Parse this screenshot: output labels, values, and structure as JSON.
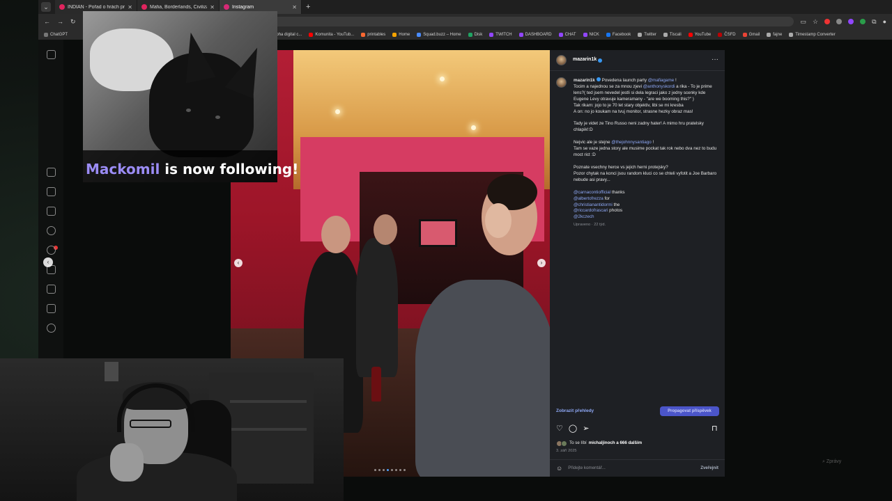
{
  "browser": {
    "tabs": [
      {
        "title": "INDIAN - Pořad o hrách pro ka",
        "active": false,
        "color": "#e0245e"
      },
      {
        "title": "Mafia, Borderlands, Civilization",
        "active": false,
        "color": "#e0245e"
      },
      {
        "title": "Instagram",
        "active": true,
        "color": "#d62976"
      }
    ],
    "bookmarks": [
      {
        "label": "ChatGPT",
        "color": "#777777"
      },
      {
        "label": "Sony Alpha digital c...",
        "color": "#555555"
      },
      {
        "label": "Komunita - YouTub...",
        "color": "#ff0000"
      },
      {
        "label": "printables",
        "color": "#fa6831"
      },
      {
        "label": "Home",
        "color": "#f4a300"
      },
      {
        "label": "Squad.buzz – Home",
        "color": "#4a8cff"
      },
      {
        "label": "Disk",
        "color": "#1fa463"
      },
      {
        "label": "TWITCH",
        "color": "#9146ff"
      },
      {
        "label": "DASHBOARD",
        "color": "#9146ff"
      },
      {
        "label": "CHAT",
        "color": "#9146ff"
      },
      {
        "label": "NICK",
        "color": "#9146ff"
      },
      {
        "label": "Facebook",
        "color": "#1877f2"
      },
      {
        "label": "Twitter",
        "color": "#aaaaaa"
      },
      {
        "label": "Tiscali",
        "color": "#aaaaaa"
      },
      {
        "label": "YouTube",
        "color": "#ff0000"
      },
      {
        "label": "ČSFD",
        "color": "#ba0305"
      },
      {
        "label": "Gmail",
        "color": "#ea4335"
      },
      {
        "label": "fajne",
        "color": "#aaaaaa"
      },
      {
        "label": "Timestamp Converter",
        "color": "#aaaaaa"
      }
    ]
  },
  "overlay": {
    "follower": "Mackomil",
    "follow_text": " is now following!"
  },
  "post": {
    "username": "mazarin1k",
    "caption": [
      {
        "mention": "",
        "text": "Povedena launch party ",
        "trail_mention": "@mafiagame",
        "trail": " !"
      },
      {
        "line": "Tocim a najednou se za mnou zjevi @anthonyskordi a rika - To je prime lens?( ted jsem nevedel jestli si dela legraci jako z jedny scenky kde Eugene Levy otravuje kameramany - \"are we booming this?\" )"
      },
      {
        "line": "Tak rikam: jojo to je 70 let stary objektiv, libi se mi kresba"
      },
      {
        "line": "A on: no jo koukam na tvuj monitor, strasne hezky obraz mas!"
      },
      {
        "line": ""
      },
      {
        "line": "Tady je videt ze Tino Russo neni zadny hater! A mimo hru pratelsky chlapik!:D"
      },
      {
        "line": ""
      },
      {
        "line": "Nejvic ale je stejne @thejohnnysantiago !"
      },
      {
        "line": "Tam se vaze jedna story ale musime pockat tak rok nebo dva nez to budu moct rict :D"
      },
      {
        "line": ""
      },
      {
        "line": "Poznate vsechny herce vs jejich herni protejsky?"
      },
      {
        "line": "Pozor chytak na konci jsou random kluci co se chteli vyfotit a Joe Barbaro nebude asi pravy..."
      },
      {
        "line": ""
      }
    ],
    "credits": [
      {
        "handle": "@carnacontiofficial",
        "text": " thanks"
      },
      {
        "handle": "@albertofrezza",
        "text": " for"
      },
      {
        "handle": "@christianantidormi",
        "text": " the"
      },
      {
        "handle": "@riccardofrascari",
        "text": " photos"
      },
      {
        "handle": "@2kczech",
        "text": ""
      }
    ],
    "edited_meta": "Upraveno · 22 týd.",
    "insights_label": "Zobrazit přehledy",
    "promote_label": "Propagovat příspěvek",
    "likes_prefix": "To se líbí ",
    "likes_bold": "michaljinoch a 666 dalším",
    "date": "3. září 2025",
    "comment_placeholder": "Přidejte komentář...",
    "post_label": "Zveřejnit"
  },
  "messages_label": "Zprávy",
  "accent_colors": {
    "link": "#8ea8f5",
    "promote": "#4b55c9",
    "follow_name": "#9b8cf5"
  }
}
